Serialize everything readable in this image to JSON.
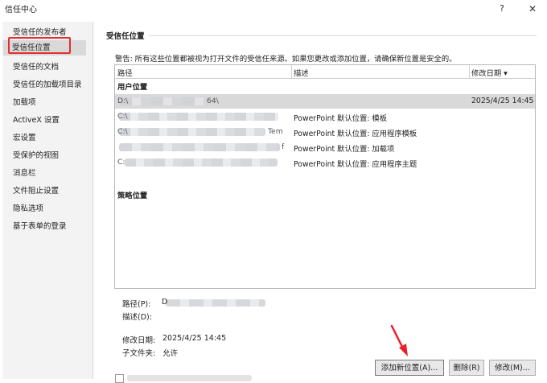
{
  "window": {
    "title": "信任中心",
    "help": "?",
    "close": "✕"
  },
  "sidebar": {
    "items": [
      {
        "label": "受信任的发布者"
      },
      {
        "label": "受信任位置"
      },
      {
        "label": "受信任的文档"
      },
      {
        "label": "受信任的加载项目录"
      },
      {
        "label": "加载项"
      },
      {
        "label": "ActiveX 设置"
      },
      {
        "label": "宏设置"
      },
      {
        "label": "受保护的视图"
      },
      {
        "label": "消息栏"
      },
      {
        "label": "文件阻止设置"
      },
      {
        "label": "隐私选项"
      },
      {
        "label": "基于表单的登录"
      }
    ],
    "selected_index": 1
  },
  "main": {
    "heading": "受信任位置",
    "warning": "警告: 所有这些位置都被视为打开文件的受信任来源。如果您更改或添加位置，请确保新位置是安全的。",
    "table": {
      "columns": [
        "路径",
        "描述",
        "修改日期 ▾"
      ],
      "user_group": "用户位置",
      "policy_group": "策略位置",
      "rows": [
        {
          "path_prefix": "D:\\",
          "path_suffix": "64\\",
          "description": "",
          "date": "2025/4/25 14:45"
        },
        {
          "path_prefix": "C:\\",
          "path_suffix": "",
          "description": "PowerPoint 默认位置: 模板",
          "date": ""
        },
        {
          "path_prefix": "C:\\",
          "path_suffix": "Tem",
          "description": "PowerPoint 默认位置: 应用程序模板",
          "date": ""
        },
        {
          "path_prefix": "",
          "path_suffix": "f",
          "description": "PowerPoint 默认位置: 加载项",
          "date": ""
        },
        {
          "path_prefix": "C:",
          "path_suffix": "",
          "description": "PowerPoint 默认位置: 应用程序主题",
          "date": ""
        }
      ]
    },
    "details": {
      "path_label": "路径(P):",
      "path_value_prefix": "D",
      "desc_label": "描述(D):",
      "modified_label": "修改日期:",
      "modified_value": "2025/4/25 14:45",
      "subfolders_label": "子文件夹:",
      "subfolders_value": "允许"
    },
    "buttons": {
      "add": "添加新位置(A)...",
      "remove": "删除(R)",
      "modify": "修改(M)..."
    }
  },
  "colors": {
    "accent_red": "#e52e2e",
    "arrow_red": "#e8202a",
    "selected_bg": "#d9d9d9"
  }
}
